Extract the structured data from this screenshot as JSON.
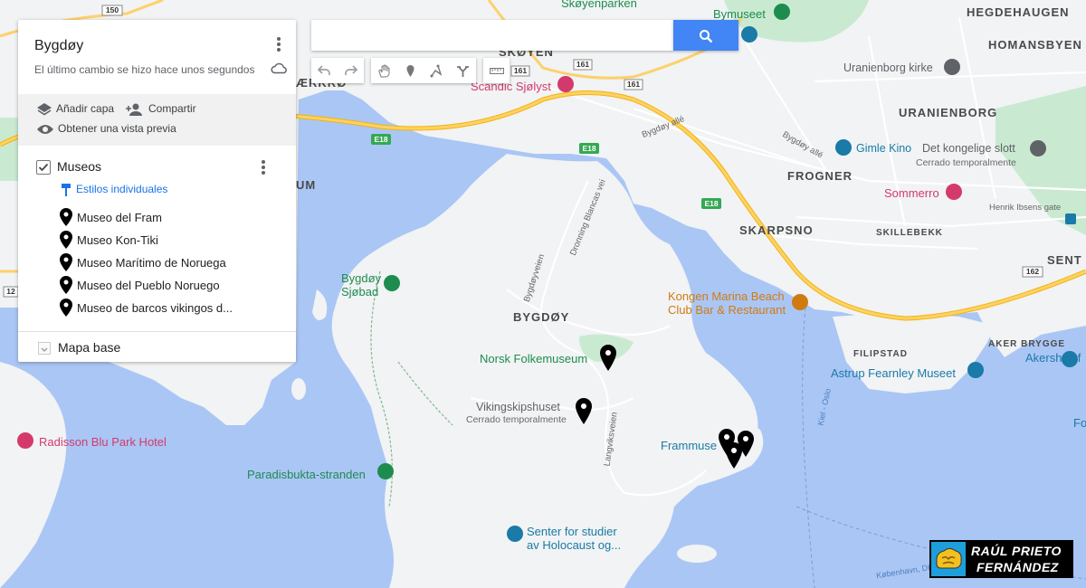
{
  "panel": {
    "title": "Bygdøy",
    "subtitle": "El último cambio se hizo hace unos segundos",
    "actions": {
      "add_layer": "Añadir capa",
      "share": "Compartir",
      "preview": "Obtener una vista previa"
    },
    "layer": {
      "name": "Museos",
      "styles_link": "Estilos individuales",
      "places": [
        "Museo del Fram",
        "Museo Kon-Tiki",
        "Museo Marítimo de Noruega",
        "Museo del Pueblo Noruego",
        "Museo de barcos vikingos d..."
      ]
    },
    "base_map": "Mapa base"
  },
  "search": {
    "value": "",
    "placeholder": ""
  },
  "toolbar_icons": [
    "undo-icon",
    "redo-icon",
    "hand-icon",
    "marker-icon",
    "line-icon",
    "route-icon",
    "ruler-icon"
  ],
  "map_labels": {
    "districts": {
      "skoyen": "SKØYEN",
      "bygdoy": "BYGDØY",
      "frogner": "FROGNER",
      "skarpsno": "SKARPSNO",
      "uranienborg": "URANIENBORG",
      "homansbyen": "HOMANSBYEN",
      "hegdehaugen": "HEGDEHAUGEN",
      "skillebekk": "SKILLEBEKK",
      "aker_brygge": "AKER BRYGGE",
      "filipstad": "FILIPSTAD",
      "sent": "SENT",
      "aerkrd": "ÆRKRØ",
      "um": "UM"
    },
    "pois": {
      "skoyenparken": "Skøyenparken",
      "bymuseet": "Bymuseet",
      "scandic": "Scandic Sjølyst",
      "uranienborg_kirke": "Uranienborg kirke",
      "gimle": "Gimle Kino",
      "slott": "Det kongelige slott",
      "slott_sub": "Cerrado temporalmente",
      "sommerro": "Sommerro",
      "bygdoy_sjobad_1": "Bygdøy",
      "bygdoy_sjobad_2": "Sjøbad",
      "kongen_1": "Kongen Marina Beach",
      "kongen_2": "Club Bar & Restaurant",
      "folkemuseum": "Norsk Folkemuseum",
      "vikingskip": "Vikingskipshuset",
      "vikingskip_sub": "Cerrado temporalmente",
      "astrup": "Astrup Fearnley Museet",
      "akershus": "Akershus f",
      "frammuseet": "Frammuse",
      "radisson": "Radisson Blu Park Hotel",
      "paradisbukta": "Paradisbukta-stranden",
      "holocaust_1": "Senter for studier",
      "holocaust_2": "av Holocaust og...",
      "fo": "Fo"
    },
    "streets": {
      "bygdoy_alle_1": "Bygdøy allé",
      "bygdoy_alle_2": "Bygdøy allé",
      "dronning": "Dronning Blancas vei",
      "bygdoyveien": "Bygdøyveien",
      "langviksveien": "Langviksveien",
      "henrik": "Henrik Ibsens gate",
      "kiel": "Kiel - Oslo",
      "ferry": "København, DK - Oslo, NO / Oslo, NO - København,"
    },
    "shields": {
      "e18_a": "E18",
      "e18_b": "E18",
      "e18_c": "E18",
      "r161_a": "161",
      "r161_b": "161",
      "r161_c": "161",
      "r150": "150",
      "r162": "162",
      "r12": "12"
    }
  },
  "logo": {
    "line1": "RAÚL PRIETO",
    "line2": "FERNÁNDEZ"
  },
  "colors": {
    "water": "#aac6f5",
    "land": "#f1f3f4",
    "park": "#c9ead1",
    "highway": "#fcd16b",
    "accent": "#4285f4"
  }
}
